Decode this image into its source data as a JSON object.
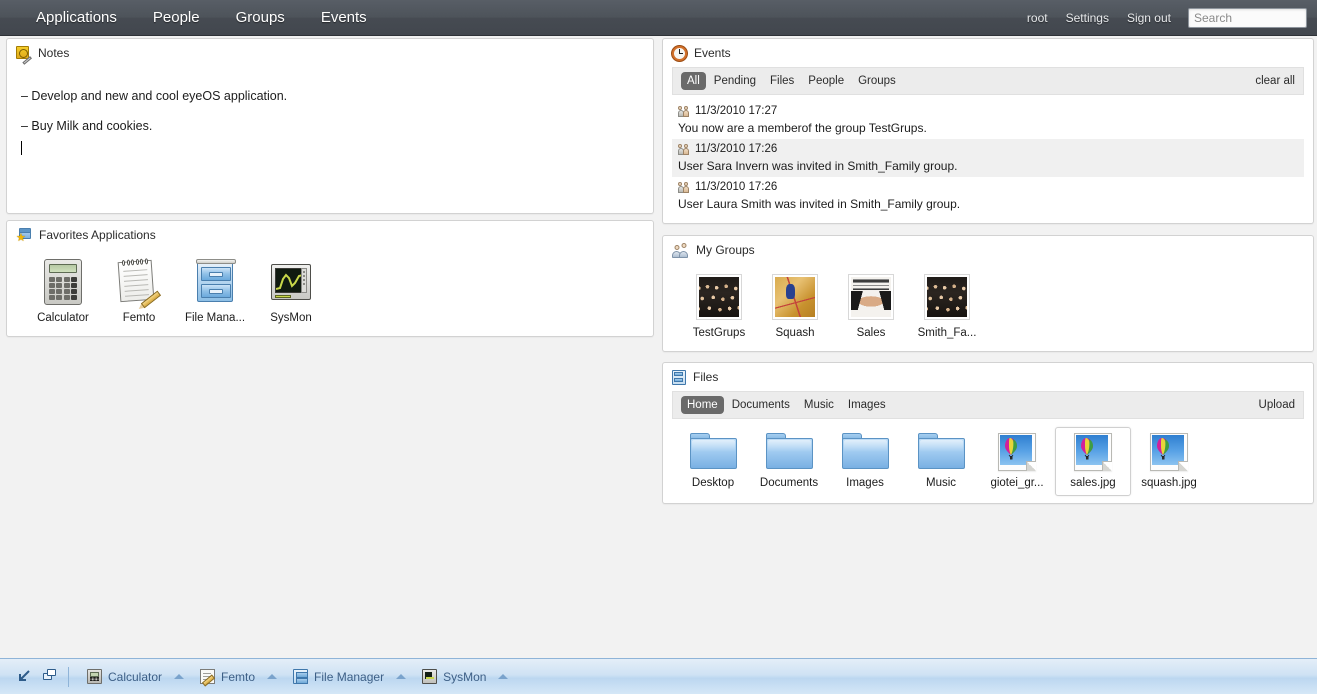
{
  "topbar": {
    "nav": [
      {
        "label": "Applications",
        "name": "applications"
      },
      {
        "label": "People",
        "name": "people"
      },
      {
        "label": "Groups",
        "name": "groups"
      },
      {
        "label": "Events",
        "name": "events"
      }
    ],
    "user": "root",
    "settings": "Settings",
    "signout": "Sign out",
    "search_placeholder": "Search",
    "search_value": "",
    "bg_color": "#4b5058"
  },
  "notes": {
    "title": "Notes",
    "icon": "notes-icon",
    "lines": [
      "– Develop and new and cool eyeOS application.",
      "– Buy Milk and cookies."
    ]
  },
  "favorites": {
    "title": "Favorites Applications",
    "icon": "favorites-icon",
    "apps": [
      {
        "label": "Calculator",
        "icon": "calculator-icon"
      },
      {
        "label": "Femto",
        "icon": "femto-icon"
      },
      {
        "label": "File Mana...",
        "icon": "file-manager-icon"
      },
      {
        "label": "SysMon",
        "icon": "sysmon-icon"
      }
    ]
  },
  "events": {
    "title": "Events",
    "icon": "clock-icon",
    "filters": [
      {
        "label": "All",
        "active": true
      },
      {
        "label": "Pending",
        "active": false
      },
      {
        "label": "Files",
        "active": false
      },
      {
        "label": "People",
        "active": false
      },
      {
        "label": "Groups",
        "active": false
      }
    ],
    "clear_all": "clear all",
    "items": [
      {
        "time": "11/3/2010 17:27",
        "text": "You now are a memberof the group TestGrups.",
        "icon": "group-event-icon"
      },
      {
        "time": "11/3/2010 17:26",
        "text": "User Sara Invern was invited in Smith_Family group.",
        "icon": "group-event-icon"
      },
      {
        "time": "11/3/2010 17:26",
        "text": "User Laura Smith was invited in Smith_Family group.",
        "icon": "group-event-icon"
      }
    ],
    "active_pill_color": "#6a6a6a"
  },
  "groups": {
    "title": "My Groups",
    "icon": "people-icon",
    "items": [
      {
        "label": "TestGrups",
        "thumb": "group-photo"
      },
      {
        "label": "Squash",
        "thumb": "squash-photo"
      },
      {
        "label": "Sales",
        "thumb": "sales-photo"
      },
      {
        "label": "Smith_Fa...",
        "thumb": "group-photo"
      }
    ]
  },
  "files": {
    "title": "Files",
    "icon": "file-cabinet-icon",
    "tabs": [
      {
        "label": "Home",
        "active": true
      },
      {
        "label": "Documents",
        "active": false
      },
      {
        "label": "Music",
        "active": false
      },
      {
        "label": "Images",
        "active": false
      }
    ],
    "upload": "Upload",
    "items": [
      {
        "label": "Desktop",
        "type": "folder",
        "selected": false
      },
      {
        "label": "Documents",
        "type": "folder",
        "selected": false
      },
      {
        "label": "Images",
        "type": "folder",
        "selected": false
      },
      {
        "label": "Music",
        "type": "folder",
        "selected": false
      },
      {
        "label": "giotei_gr...",
        "type": "image",
        "selected": false
      },
      {
        "label": "sales.jpg",
        "type": "image",
        "selected": true
      },
      {
        "label": "squash.jpg",
        "type": "image",
        "selected": false
      }
    ]
  },
  "taskbar": {
    "system_icons": [
      {
        "name": "show-desktop-icon"
      },
      {
        "name": "window-switcher-icon"
      }
    ],
    "items": [
      {
        "label": "Calculator",
        "icon": "calculator-icon"
      },
      {
        "label": "Femto",
        "icon": "femto-icon"
      },
      {
        "label": "File Manager",
        "icon": "file-manager-icon"
      },
      {
        "label": "SysMon",
        "icon": "sysmon-icon"
      }
    ],
    "bg_color": "#cfe2f4"
  }
}
